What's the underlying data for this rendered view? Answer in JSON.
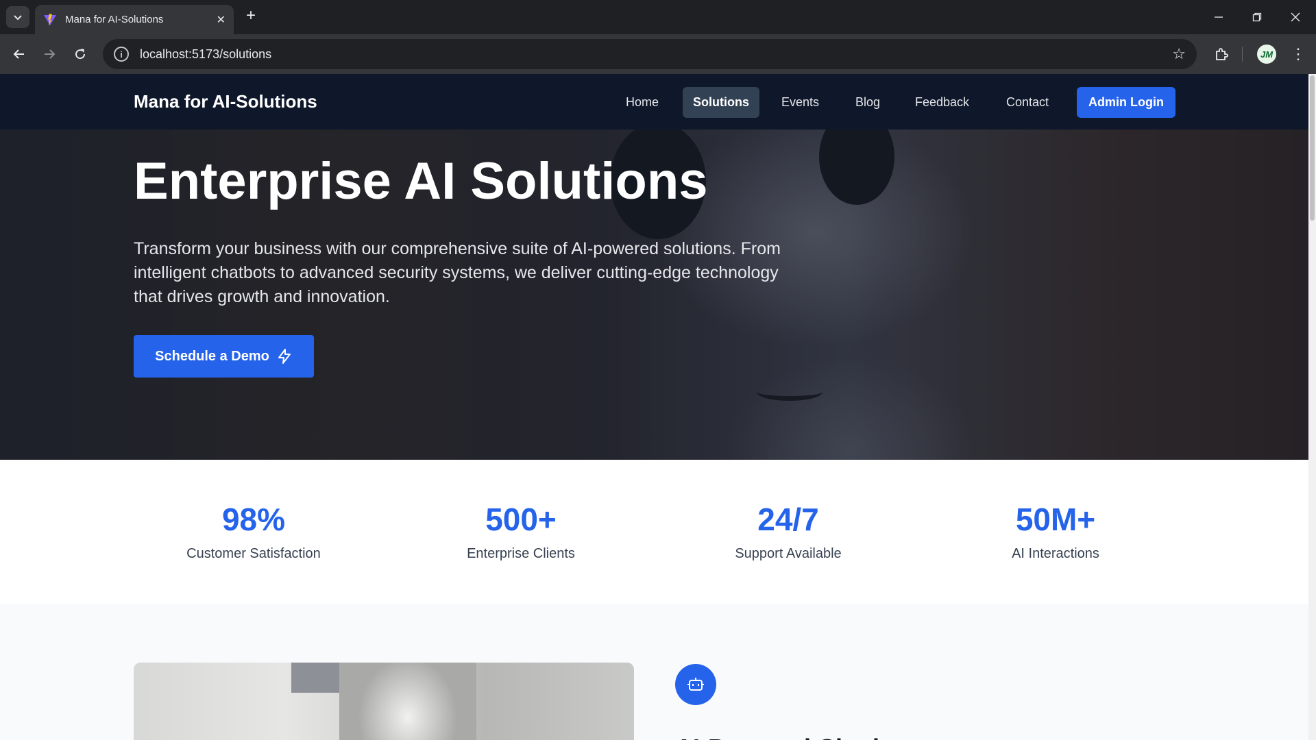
{
  "browser": {
    "tab_title": "Mana for AI-Solutions",
    "url": "localhost:5173/solutions",
    "avatar_initials": "JM"
  },
  "site": {
    "brand": "Mana for AI-Solutions",
    "nav": [
      {
        "label": "Home",
        "active": false
      },
      {
        "label": "Solutions",
        "active": true
      },
      {
        "label": "Events",
        "active": false
      },
      {
        "label": "Blog",
        "active": false
      },
      {
        "label": "Feedback",
        "active": false
      },
      {
        "label": "Contact",
        "active": false
      }
    ],
    "admin_login": "Admin Login"
  },
  "hero": {
    "title": "Enterprise AI Solutions",
    "text": "Transform your business with our comprehensive suite of AI-powered solutions. From intelligent chatbots to advanced security systems, we deliver cutting-edge technology that drives growth and innovation.",
    "cta": "Schedule a Demo"
  },
  "stats": [
    {
      "value": "98%",
      "label": "Customer Satisfaction"
    },
    {
      "value": "500+",
      "label": "Enterprise Clients"
    },
    {
      "value": "24/7",
      "label": "Support Available"
    },
    {
      "value": "50M+",
      "label": "AI Interactions"
    }
  ],
  "feature": {
    "title": "AI-Powered Chatbots",
    "icon": "bot-icon"
  },
  "colors": {
    "accent": "#2563eb",
    "nav_bg": "#0f172a"
  }
}
